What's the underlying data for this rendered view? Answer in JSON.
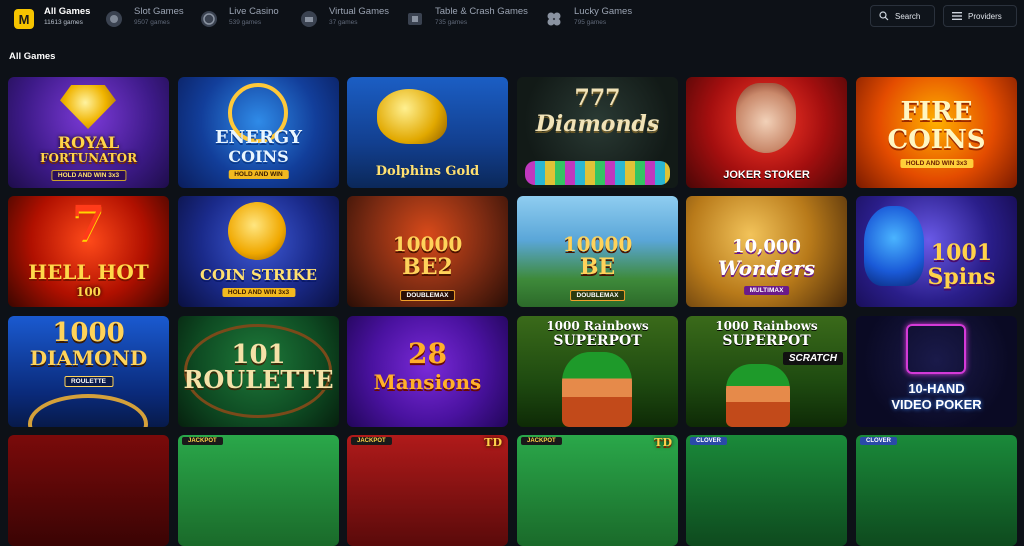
{
  "categories": [
    {
      "name": "All Games",
      "count": "11613 games",
      "icon": "logo-m-icon"
    },
    {
      "name": "Slot Games",
      "count": "9507 games",
      "icon": "slot-icon"
    },
    {
      "name": "Live Casino",
      "count": "539 games",
      "icon": "live-casino-icon"
    },
    {
      "name": "Virtual Games",
      "count": "37 games",
      "icon": "virtual-games-icon"
    },
    {
      "name": "Table & Crash Games",
      "count": "735 games",
      "icon": "table-games-icon"
    },
    {
      "name": "Lucky Games",
      "count": "795 games",
      "icon": "clover-icon"
    }
  ],
  "search": {
    "label": "Search",
    "icon": "search-icon"
  },
  "providers": {
    "label": "Providers",
    "icon": "list-icon"
  },
  "section": {
    "title": "All Games"
  },
  "games": [
    {
      "line1": "ROYAL",
      "line2": "FORTUNATOR",
      "sub": "HOLD AND WIN 3x3"
    },
    {
      "line1": "ENERGY",
      "line2": "COINS",
      "sub": "HOLD AND WIN"
    },
    {
      "line1": "Dolphins Gold",
      "line2": "",
      "sub": ""
    },
    {
      "line1": "777",
      "line2": "Diamonds",
      "sub": ""
    },
    {
      "line1": "JOKER STOKER",
      "line2": "",
      "sub": ""
    },
    {
      "line1": "FIRE",
      "line2": "COINS",
      "sub": "HOLD AND WIN 3x3"
    },
    {
      "line1": "7",
      "line2": "HELL HOT",
      "sub": "100"
    },
    {
      "line1": "COIN STRIKE",
      "line2": "",
      "sub": "HOLD AND WIN 3x3"
    },
    {
      "line1": "10000",
      "line2": "BE2",
      "sub": "DOUBLEMAX"
    },
    {
      "line1": "10000",
      "line2": "BE",
      "sub": "DOUBLEMAX"
    },
    {
      "line1": "10,000",
      "line2": "Wonders",
      "sub": "MULTIMAX"
    },
    {
      "line1": "1001",
      "line2": "Spins",
      "sub": ""
    },
    {
      "line1": "1000",
      "line2": "DIAMOND",
      "sub": "ROULETTE"
    },
    {
      "line1": "101",
      "line2": "ROULETTE",
      "sub": ""
    },
    {
      "line1": "28",
      "line2": "Mansions",
      "sub": ""
    },
    {
      "line1": "1000 Rainbows",
      "line2": "SUPERPOT",
      "sub": ""
    },
    {
      "line1": "1000 Rainbows",
      "line2": "SUPERPOT",
      "sub": "SCRATCH"
    },
    {
      "line1": "10-HAND",
      "line2": "VIDEO POKER",
      "sub": ""
    },
    {
      "line1": "",
      "line2": "",
      "sub": ""
    },
    {
      "line1": "JACKPOT",
      "line2": "",
      "sub": ""
    },
    {
      "line1": "JACKPOT",
      "line2": "TD",
      "sub": ""
    },
    {
      "line1": "JACKPOT",
      "line2": "TD",
      "sub": ""
    },
    {
      "line1": "CLOVER",
      "line2": "",
      "sub": ""
    },
    {
      "line1": "CLOVER",
      "line2": "",
      "sub": ""
    }
  ]
}
